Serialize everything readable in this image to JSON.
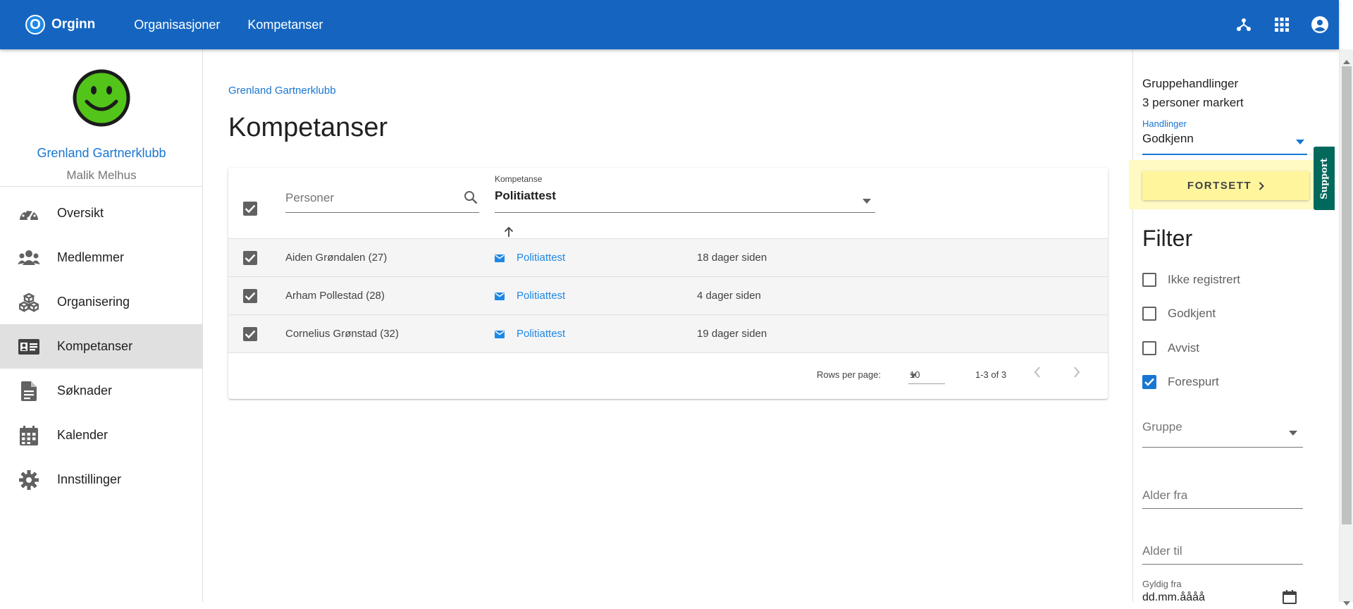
{
  "header": {
    "logo_letter": "O",
    "brand": "Orginn",
    "nav": [
      "Organisasjoner",
      "Kompetanser"
    ],
    "icons": [
      "hierarchy-icon",
      "apps-grid-icon",
      "account-circle-icon"
    ],
    "color": "#1565c0"
  },
  "sidebar": {
    "org_name": "Grenland Gartnerklubb",
    "user_name": "Malik Melhus",
    "avatar_color": "#52c41a",
    "items": [
      {
        "label": "Oversikt",
        "icon": "speedometer-icon"
      },
      {
        "label": "Medlemmer",
        "icon": "people-icon"
      },
      {
        "label": "Organisering",
        "icon": "cubes-icon"
      },
      {
        "label": "Kompetanser",
        "icon": "id-card-icon",
        "active": true
      },
      {
        "label": "Søknader",
        "icon": "document-icon"
      },
      {
        "label": "Kalender",
        "icon": "calendar-icon"
      },
      {
        "label": "Innstillinger",
        "icon": "gear-icon"
      }
    ]
  },
  "main": {
    "breadcrumb": "Grenland Gartnerklubb",
    "title": "Kompetanser",
    "table": {
      "persons_placeholder": "Personer",
      "kompetanse_label": "Kompetanse",
      "kompetanse_value": "Politiattest",
      "rows": [
        {
          "name": "Aiden Grøndalen (27)",
          "kompetanse": "Politiattest",
          "time": "18 dager siden",
          "checked": true
        },
        {
          "name": "Arham Pollestad (28)",
          "kompetanse": "Politiattest",
          "time": "4 dager siden",
          "checked": true
        },
        {
          "name": "Cornelius Grønstad (32)",
          "kompetanse": "Politiattest",
          "time": "19 dager siden",
          "checked": true
        }
      ],
      "rows_per_page_label": "Rows per page:",
      "rows_per_page": "10",
      "range": "1-3 of 3"
    }
  },
  "panel": {
    "group_actions_title": "Gruppehandlinger",
    "selected_count": "3 personer markert",
    "actions_label": "Handlinger",
    "actions_value": "Godkjenn",
    "continue_label": "FORTSETT",
    "filter_title": "Filter",
    "filters": [
      {
        "label": "Ikke registrert",
        "checked": false
      },
      {
        "label": "Godkjent",
        "checked": false
      },
      {
        "label": "Avvist",
        "checked": false
      },
      {
        "label": "Forespurt",
        "checked": true
      }
    ],
    "group_label": "Gruppe",
    "age_from_label": "Alder fra",
    "age_to_label": "Alder til",
    "valid_from_label": "Gyldig fra",
    "valid_from_placeholder": "dd.mm.åååå"
  },
  "support_label": "Support"
}
